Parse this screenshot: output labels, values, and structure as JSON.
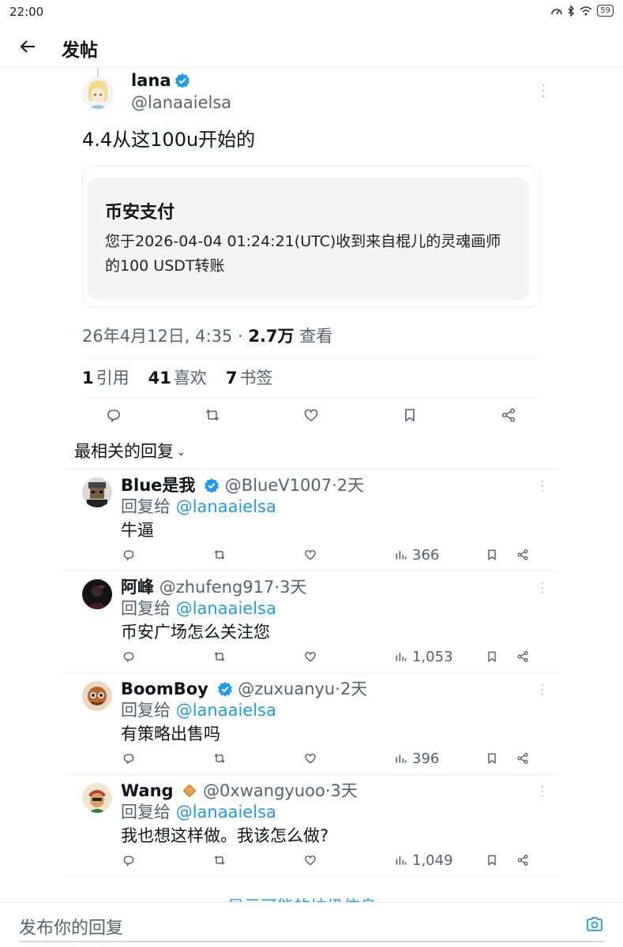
{
  "status_bar": {
    "time": "22:00",
    "battery": "59"
  },
  "header": {
    "back_icon": "arrow-left-icon",
    "title": "发帖"
  },
  "tweet": {
    "author_name": "lana",
    "author_handle": "@lanaaielsa",
    "text": "4.4从这100u开始的",
    "embed": {
      "title": "币安支付",
      "body": "您于2026-04-04 01:24:21(UTC)收到来自棍儿的灵魂画师的100 USDT转账"
    },
    "meta": {
      "datetime": "26年4月12日, 4:35",
      "separator": " · ",
      "views": "2.7万",
      "views_label": " 查看"
    },
    "stats": [
      {
        "count": "1",
        "label": "引用"
      },
      {
        "count": "41",
        "label": "喜欢"
      },
      {
        "count": "7",
        "label": "书签"
      }
    ]
  },
  "replies_sort": {
    "label": "最相关的回复"
  },
  "replies": [
    {
      "name": "Blue是我",
      "badge": "verified",
      "handle": "@BlueV1007",
      "time": "2天",
      "reply_prefix": "回复给",
      "reply_to": "@lanaaielsa",
      "text": "牛逼",
      "views": "366"
    },
    {
      "name": "阿峰",
      "badge": "none",
      "handle": "@zhufeng917",
      "time": "3天",
      "reply_prefix": "回复给",
      "reply_to": "@lanaaielsa",
      "text": "币安广场怎么关注您",
      "views": "1,053"
    },
    {
      "name": "BoomBoy",
      "badge": "verified",
      "handle": "@zuxuanyu",
      "time": "2天",
      "reply_prefix": "回复给",
      "reply_to": "@lanaaielsa",
      "text": "有策略出售吗",
      "views": "396"
    },
    {
      "name": "Wang",
      "badge": "diamond",
      "handle": "@0xwangyuoo",
      "time": "3天",
      "reply_prefix": "回复给",
      "reply_to": "@lanaaielsa",
      "text": "我也想这样做。我该怎么做?",
      "views": "1,049"
    }
  ],
  "show_more": {
    "label": "显示可能的垃圾信息"
  },
  "compose": {
    "placeholder": "发布你的回复"
  },
  "colors": {
    "accent": "#1d9bf0",
    "text": "#0f1419",
    "muted": "#536471",
    "border": "#eff3f4"
  }
}
